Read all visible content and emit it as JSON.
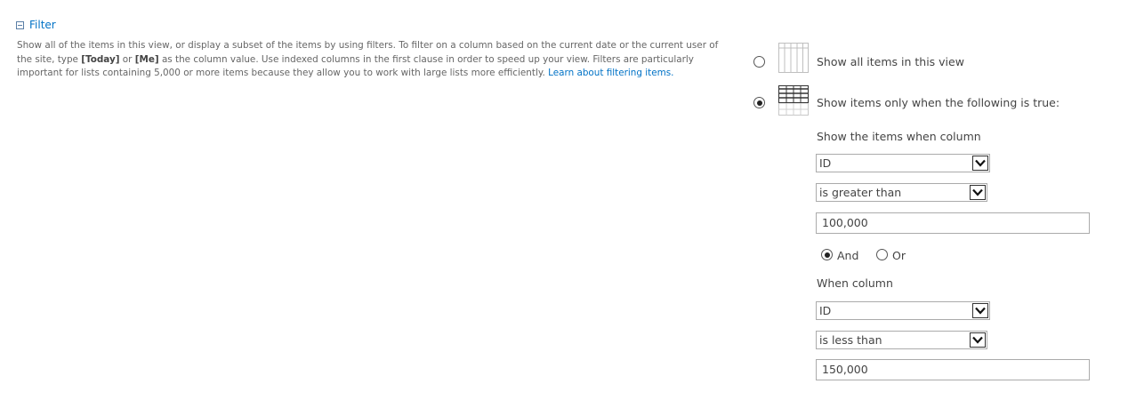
{
  "section": {
    "icon": "collapse-minus-icon",
    "title": "Filter"
  },
  "description": {
    "text1": "Show all of the items in this view, or display a subset of the items by using filters. To filter on a column based on the current date or the current user of the site, type ",
    "today": "[Today]",
    "or": " or ",
    "me": "[Me]",
    "text2": " as the column value. Use indexed columns in the first clause in order to speed up your view. Filters are particularly important for lists containing 5,000 or more items because they allow you to work with large lists more efficiently. ",
    "link": "Learn about filtering items."
  },
  "options": {
    "show_all": {
      "label": "Show all items in this view",
      "checked": false,
      "icon": "grid-view-icon"
    },
    "show_filtered": {
      "label": "Show items only when the following is true:",
      "checked": true,
      "icon": "filtered-grid-icon"
    }
  },
  "filter": {
    "clause1_label": "Show the items when column",
    "clause1": {
      "column": "ID",
      "operator": "is greater than",
      "value": "100,000"
    },
    "logic": {
      "and_label": "And",
      "or_label": "Or",
      "selected": "And"
    },
    "clause2_label": "When column",
    "clause2": {
      "column": "ID",
      "operator": "is less than",
      "value": "150,000"
    }
  }
}
